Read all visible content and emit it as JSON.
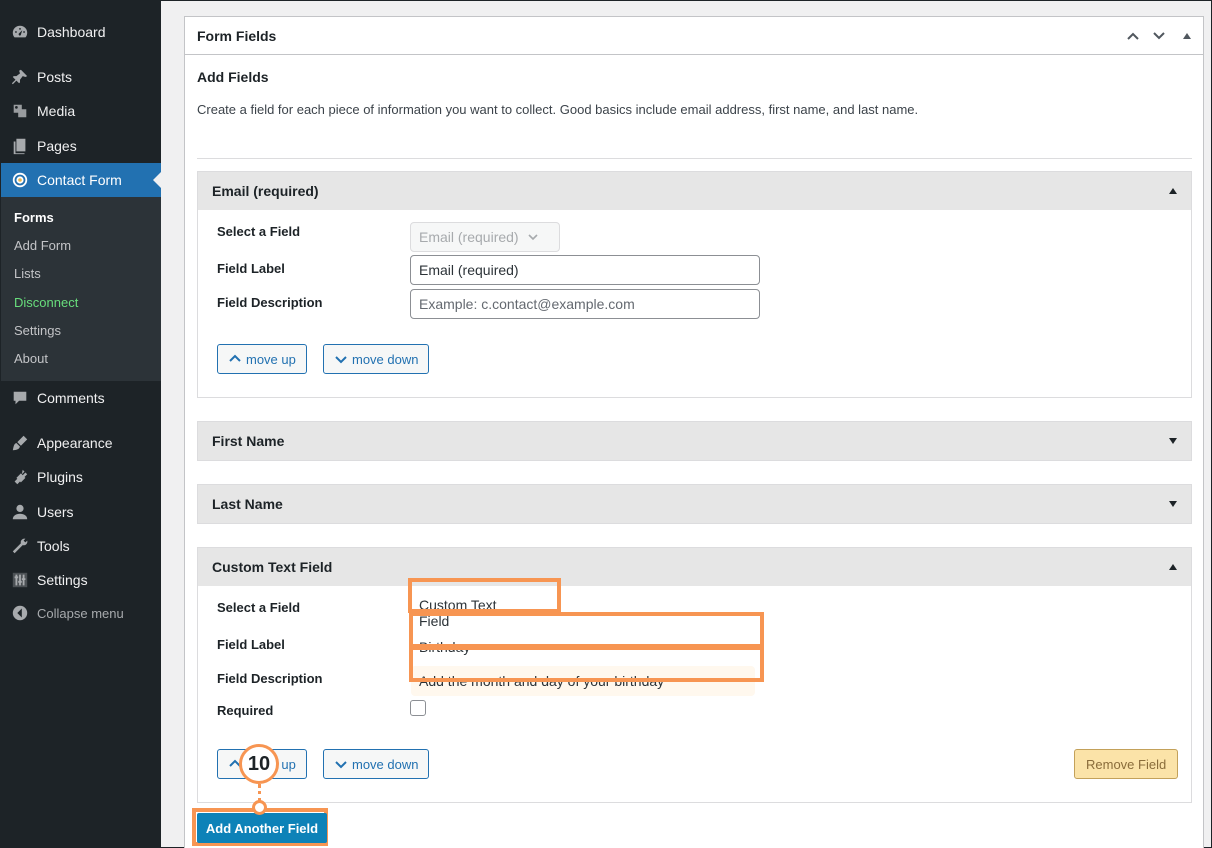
{
  "sidebar": {
    "menu": {
      "dashboard": {
        "label": "Dashboard",
        "icon": "dashboard-icon"
      },
      "posts": {
        "label": "Posts",
        "icon": "pin-icon"
      },
      "media": {
        "label": "Media",
        "icon": "media-icon"
      },
      "pages": {
        "label": "Pages",
        "icon": "pages-icon"
      },
      "contact_form": {
        "label": "Contact Form",
        "icon": "contact-form-logo-icon"
      },
      "comments": {
        "label": "Comments",
        "icon": "comment-icon"
      },
      "appearance": {
        "label": "Appearance",
        "icon": "paintbrush-icon"
      },
      "plugins": {
        "label": "Plugins",
        "icon": "plugin-icon"
      },
      "users": {
        "label": "Users",
        "icon": "user-icon"
      },
      "tools": {
        "label": "Tools",
        "icon": "wrench-icon"
      },
      "settings": {
        "label": "Settings",
        "icon": "settings-sliders-icon"
      },
      "collapse": {
        "label": "Collapse menu",
        "icon": "collapse-arrow-icon"
      }
    },
    "submenu": {
      "forms": "Forms",
      "add_form": "Add Form",
      "lists": "Lists",
      "disconnect": "Disconnect",
      "settings": "Settings",
      "about": "About"
    }
  },
  "postbox": {
    "title": "Form Fields",
    "add_fields_title": "Add Fields",
    "add_fields_desc": "Create a field for each piece of information you want to collect. Good basics include email address, first name, and last name."
  },
  "labels": {
    "select_field": "Select a Field",
    "field_label": "Field Label",
    "field_description": "Field Description",
    "required": "Required",
    "move_up": "move up",
    "move_down": "move down",
    "remove_field": "Remove Field"
  },
  "fields": {
    "email": {
      "header": "Email (required)",
      "select_value": "Email (required)",
      "label_value": "Email (required)",
      "description_placeholder": "Example: c.contact@example.com"
    },
    "first_name": {
      "header": "First Name"
    },
    "last_name": {
      "header": "Last Name"
    },
    "custom": {
      "header": "Custom Text Field",
      "select_value": "Custom Text Field",
      "label_value": "Birthday",
      "description_value": "Add the month and day of your birthday",
      "required_checked": false
    }
  },
  "add_another_button": "Add Another Field",
  "callout": {
    "step": "10"
  },
  "colors": {
    "sidebar_bg": "#1d2327",
    "active_menu": "#2271b1",
    "primary_button": "#0d82b8",
    "highlight": "#f79552",
    "remove_button": "#fbe3a8"
  }
}
